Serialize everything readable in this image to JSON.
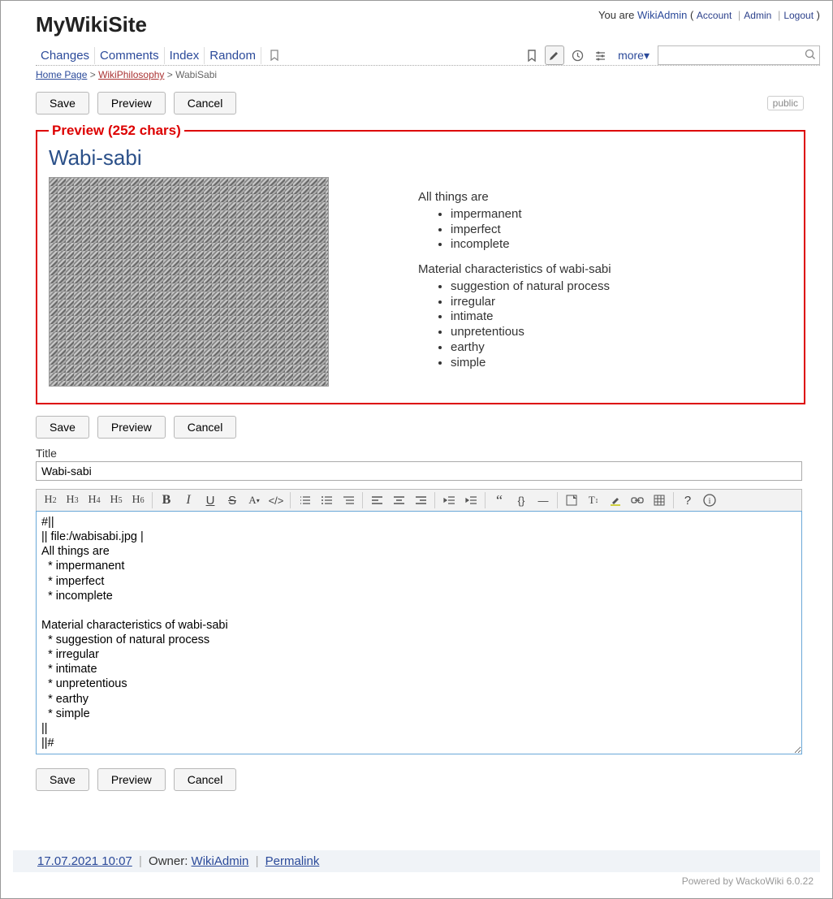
{
  "site_title": "MyWikiSite",
  "user": {
    "prefix": "You are ",
    "name": "WikiAdmin",
    "account": "Account",
    "admin": "Admin",
    "logout": "Logout"
  },
  "nav": {
    "changes": "Changes",
    "comments": "Comments",
    "index": "Index",
    "random": "Random",
    "more": "more▾"
  },
  "breadcrumb": {
    "home": "Home Page",
    "parent": "WikiPhilosophy",
    "current": "WabiSabi"
  },
  "buttons": {
    "save": "Save",
    "preview": "Preview",
    "cancel": "Cancel",
    "public": "public"
  },
  "preview": {
    "legend": "Preview (252 chars)",
    "title": "Wabi-sabi",
    "p1": "All things are",
    "list1": [
      "impermanent",
      "imperfect",
      "incomplete"
    ],
    "p2": "Material characteristics of wabi-sabi",
    "list2": [
      "suggestion of natural process",
      "irregular",
      "intimate",
      "unpretentious",
      "earthy",
      "simple"
    ]
  },
  "title_label": "Title",
  "title_value": "Wabi-sabi",
  "editor_value": "#||\n|| file:/wabisabi.jpg |\nAll things are\n  * impermanent\n  * imperfect\n  * incomplete\n\nMaterial characteristics of wabi-sabi\n  * suggestion of natural process\n  * irregular\n  * intimate\n  * unpretentious\n  * earthy\n  * simple\n||\n||#",
  "footer": {
    "date": "17.07.2021 10:07",
    "owner_label": "Owner: ",
    "owner": "WikiAdmin",
    "permalink": "Permalink"
  },
  "powered": "Powered by WackoWiki 6.0.22"
}
